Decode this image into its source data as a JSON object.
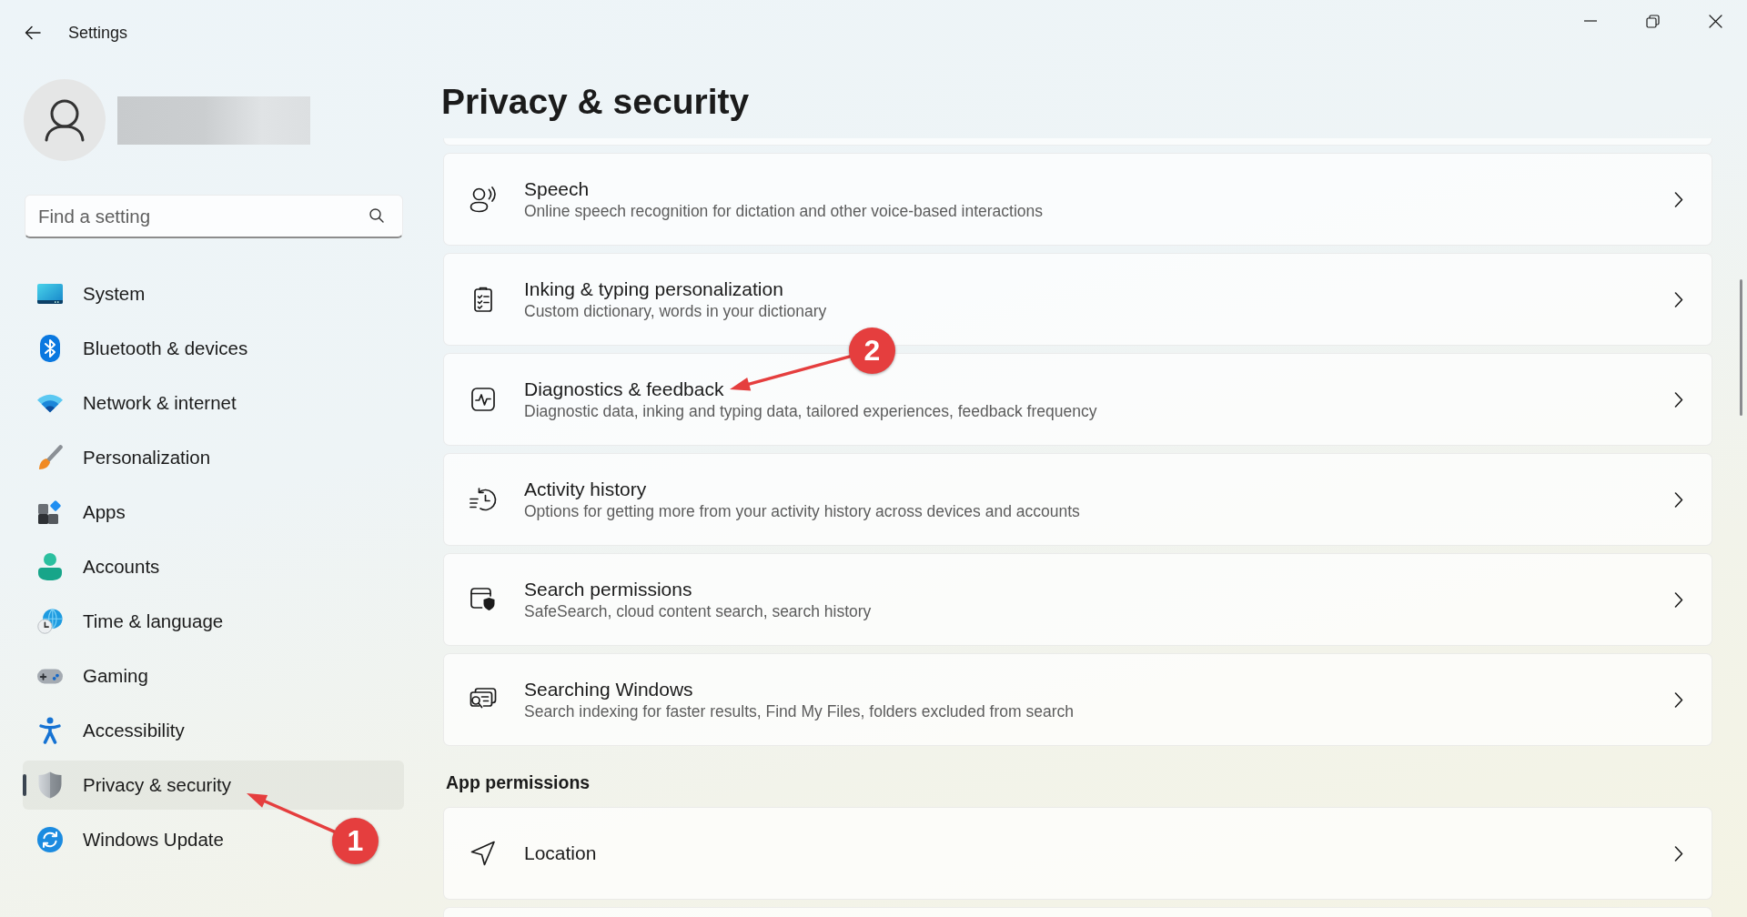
{
  "window": {
    "title": "Settings"
  },
  "search": {
    "placeholder": "Find a setting"
  },
  "sidebar": {
    "items": [
      {
        "label": "System",
        "selected": false
      },
      {
        "label": "Bluetooth & devices",
        "selected": false
      },
      {
        "label": "Network & internet",
        "selected": false
      },
      {
        "label": "Personalization",
        "selected": false
      },
      {
        "label": "Apps",
        "selected": false
      },
      {
        "label": "Accounts",
        "selected": false
      },
      {
        "label": "Time & language",
        "selected": false
      },
      {
        "label": "Gaming",
        "selected": false
      },
      {
        "label": "Accessibility",
        "selected": false
      },
      {
        "label": "Privacy & security",
        "selected": true,
        "callout": "1"
      },
      {
        "label": "Windows Update",
        "selected": false
      }
    ]
  },
  "page": {
    "title": "Privacy & security",
    "groups": [
      {
        "cards": [
          {
            "title": "Speech",
            "description": "Online speech recognition for dictation and other voice-based interactions"
          },
          {
            "title": "Inking & typing personalization",
            "description": "Custom dictionary, words in your dictionary"
          },
          {
            "title": "Diagnostics & feedback",
            "description": "Diagnostic data, inking and typing data, tailored experiences, feedback frequency",
            "callout": "2"
          },
          {
            "title": "Activity history",
            "description": "Options for getting more from your activity history across devices and accounts"
          },
          {
            "title": "Search permissions",
            "description": "SafeSearch, cloud content search, search history"
          },
          {
            "title": "Searching Windows",
            "description": "Search indexing for faster results, Find My Files, folders excluded from search"
          }
        ]
      },
      {
        "heading": "App permissions",
        "cards": [
          {
            "title": "Location"
          }
        ]
      }
    ]
  }
}
